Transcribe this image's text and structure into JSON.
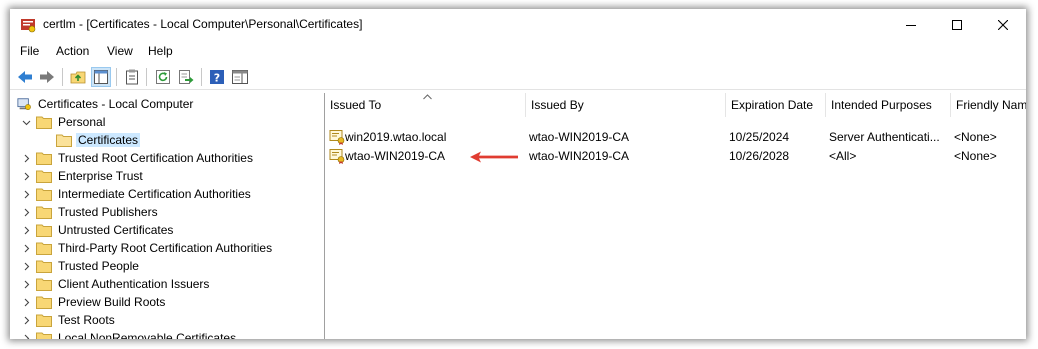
{
  "window": {
    "title": "certlm - [Certificates - Local Computer\\Personal\\Certificates]"
  },
  "menu": [
    "File",
    "Action",
    "View",
    "Help"
  ],
  "toolbar_icons": [
    "back-arrow-icon",
    "forward-arrow-icon",
    "up-folder-icon",
    "show-hide-tree-icon",
    "properties-icon",
    "refresh-icon",
    "export-list-icon",
    "help-icon",
    "console-view-icon"
  ],
  "tree": {
    "root": "Certificates - Local Computer",
    "items": [
      {
        "label": "Personal",
        "expanded": true
      },
      {
        "label": "Certificates",
        "selected": true
      },
      {
        "label": "Trusted Root Certification Authorities"
      },
      {
        "label": "Enterprise Trust"
      },
      {
        "label": "Intermediate Certification Authorities"
      },
      {
        "label": "Trusted Publishers"
      },
      {
        "label": "Untrusted Certificates"
      },
      {
        "label": "Third-Party Root Certification Authorities"
      },
      {
        "label": "Trusted People"
      },
      {
        "label": "Client Authentication Issuers"
      },
      {
        "label": "Preview Build Roots"
      },
      {
        "label": "Test Roots"
      },
      {
        "label": "Local NonRemovable Certificates"
      }
    ]
  },
  "list": {
    "columns": [
      "Issued To",
      "Issued By",
      "Expiration Date",
      "Intended Purposes",
      "Friendly Name"
    ],
    "sort_column": "Issued To",
    "rows": [
      {
        "issued_to": "win2019.wtao.local",
        "issued_by": "wtao-WIN2019-CA",
        "expiration": "10/25/2024",
        "purposes": "Server Authenticati...",
        "friendly": "<None>"
      },
      {
        "issued_to": "wtao-WIN2019-CA",
        "issued_by": "wtao-WIN2019-CA",
        "expiration": "10/26/2028",
        "purposes": "<All>",
        "friendly": "<None>"
      }
    ]
  },
  "colors": {
    "annotation_arrow": "#e03c31",
    "selection": "#cce8ff",
    "folder": "#f8d775"
  }
}
